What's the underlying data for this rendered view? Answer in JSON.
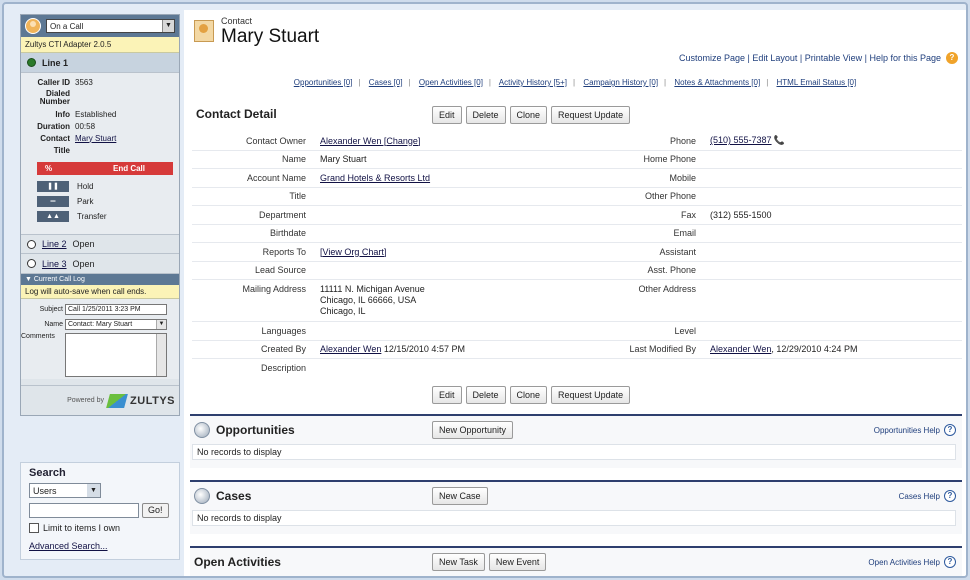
{
  "cti": {
    "status": "On a Call",
    "version": "Zultys CTI Adapter 2.0.5",
    "line1": "Line 1",
    "fields": [
      {
        "label": "Caller ID",
        "value": "3563"
      },
      {
        "label": "Dialed Number",
        "value": ""
      },
      {
        "label": "Info",
        "value": "Established"
      },
      {
        "label": "Duration",
        "value": "00:58"
      },
      {
        "label": "Contact",
        "value": "Mary Stuart"
      },
      {
        "label": "Title",
        "value": ""
      }
    ],
    "end_call": "End Call",
    "end_call_icon": "%",
    "hold": "Hold",
    "park": "Park",
    "transfer": "Transfer",
    "line2": "Line 2",
    "line2_status": "Open",
    "line3": "Line 3",
    "line3_status": "Open",
    "call_log_title": "Current Call Log",
    "autosave": "Log will auto-save when call ends.",
    "subject_label": "Subject",
    "subject_value": "Call 1/25/2011 3:23 PM",
    "name_label": "Name",
    "name_value": "Contact: Mary Stuart",
    "comments_label": "Comments",
    "powered_by": "Powered by",
    "brand": "ZULTYS"
  },
  "search": {
    "title": "Search",
    "scope": "Users",
    "go": "Go!",
    "limit": "Limit to items I own",
    "advanced": "Advanced Search..."
  },
  "header": {
    "object_type": "Contact",
    "record_name": "Mary Stuart",
    "links": "Customize Page | Edit Layout | Printable View | Help for this Page"
  },
  "related_links": [
    "Opportunities [0]",
    "Cases [0]",
    "Open Activities [0]",
    "Activity History [5+]",
    "Campaign History [0]",
    "Notes & Attachments [0]",
    "HTML Email Status [0]"
  ],
  "detail": {
    "title": "Contact Detail",
    "buttons": {
      "edit": "Edit",
      "delete": "Delete",
      "clone": "Clone",
      "request_update": "Request Update"
    },
    "rows": [
      {
        "l1": "Contact Owner",
        "v1": "Alexander Wen [Change]",
        "l2": "Phone",
        "v2": "(510) 555-7387"
      },
      {
        "l1": "Name",
        "v1": "Mary Stuart",
        "l2": "Home Phone",
        "v2": ""
      },
      {
        "l1": "Account Name",
        "v1": "Grand Hotels & Resorts Ltd",
        "l2": "Mobile",
        "v2": ""
      },
      {
        "l1": "Title",
        "v1": "",
        "l2": "Other Phone",
        "v2": ""
      },
      {
        "l1": "Department",
        "v1": "",
        "l2": "Fax",
        "v2": "(312) 555-1500"
      },
      {
        "l1": "Birthdate",
        "v1": "",
        "l2": "Email",
        "v2": ""
      },
      {
        "l1": "Reports To",
        "v1": "[View Org Chart]",
        "l2": "Assistant",
        "v2": ""
      },
      {
        "l1": "Lead Source",
        "v1": "",
        "l2": "Asst. Phone",
        "v2": ""
      }
    ],
    "address": {
      "label": "Mailing Address",
      "line1": "11111 N. Michigan Avenue",
      "line2": "Chicago, IL 66666, USA",
      "line3": "Chicago, IL",
      "other_label": "Other Address"
    },
    "rows2": [
      {
        "l1": "Languages",
        "v1": "",
        "l2": "Level",
        "v2": ""
      },
      {
        "l1": "Created By",
        "v1": "Alexander Wen",
        "v1b": "12/15/2010 4:57 PM",
        "l2": "Last Modified By",
        "v2": "Alexander Wen",
        "v2b": ", 12/29/2010 4:24 PM"
      },
      {
        "l1": "Description",
        "v1": "",
        "l2": "",
        "v2": ""
      }
    ]
  },
  "sections": {
    "opportunities": {
      "title": "Opportunities",
      "button": "New Opportunity",
      "help": "Opportunities Help",
      "empty": "No records to display"
    },
    "cases": {
      "title": "Cases",
      "button": "New Case",
      "help": "Cases Help",
      "empty": "No records to display"
    },
    "activities": {
      "title": "Open Activities",
      "button1": "New Task",
      "button2": "New Event",
      "help": "Open Activities Help"
    }
  }
}
